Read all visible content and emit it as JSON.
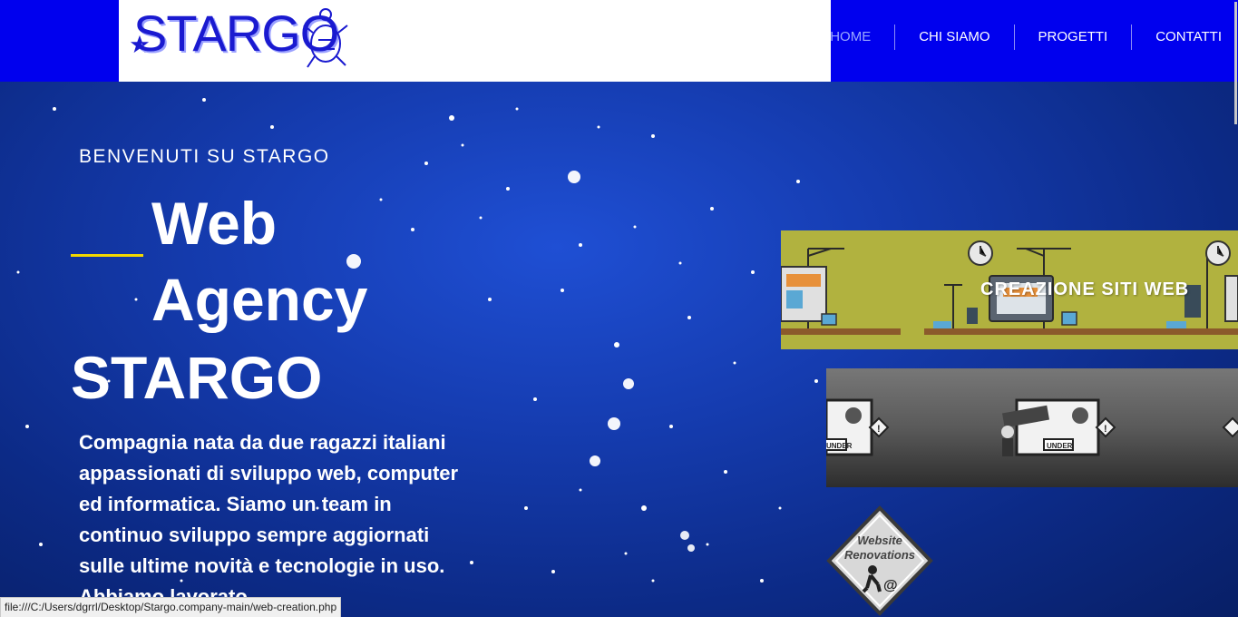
{
  "brand": {
    "logo_text": "STARGO"
  },
  "nav": {
    "items": [
      {
        "label": "HOME"
      },
      {
        "label": "CHI SIAMO"
      },
      {
        "label": "PROGETTI"
      },
      {
        "label": "CONTATTI"
      }
    ]
  },
  "hero": {
    "welcome": "BENVENUTI SU STARGO",
    "title_line1": "Web",
    "title_line2": "Agency",
    "brand": "STARGO",
    "description": "Compagnia nata da due ragazzi italiani appassionati di sviluppo web, computer ed informatica. Siamo un team in continuo sviluppo sempre aggiornati sulle ultime novità e tecnologie in uso. Abbiamo lavorato"
  },
  "cards": [
    {
      "title": "CREAZIONE SITI WEB"
    }
  ],
  "badge": {
    "line1": "Website",
    "line2": "Renovations"
  },
  "card2_labels": {
    "under": "UNDER"
  },
  "status_bar": {
    "url": "file:///C:/Users/dgrrl/Desktop/Stargo.company-main/web-creation.php"
  },
  "colors": {
    "topbar": "#0000ee",
    "accent_line": "#f2d800",
    "card1_bg": "#b1b23f"
  }
}
